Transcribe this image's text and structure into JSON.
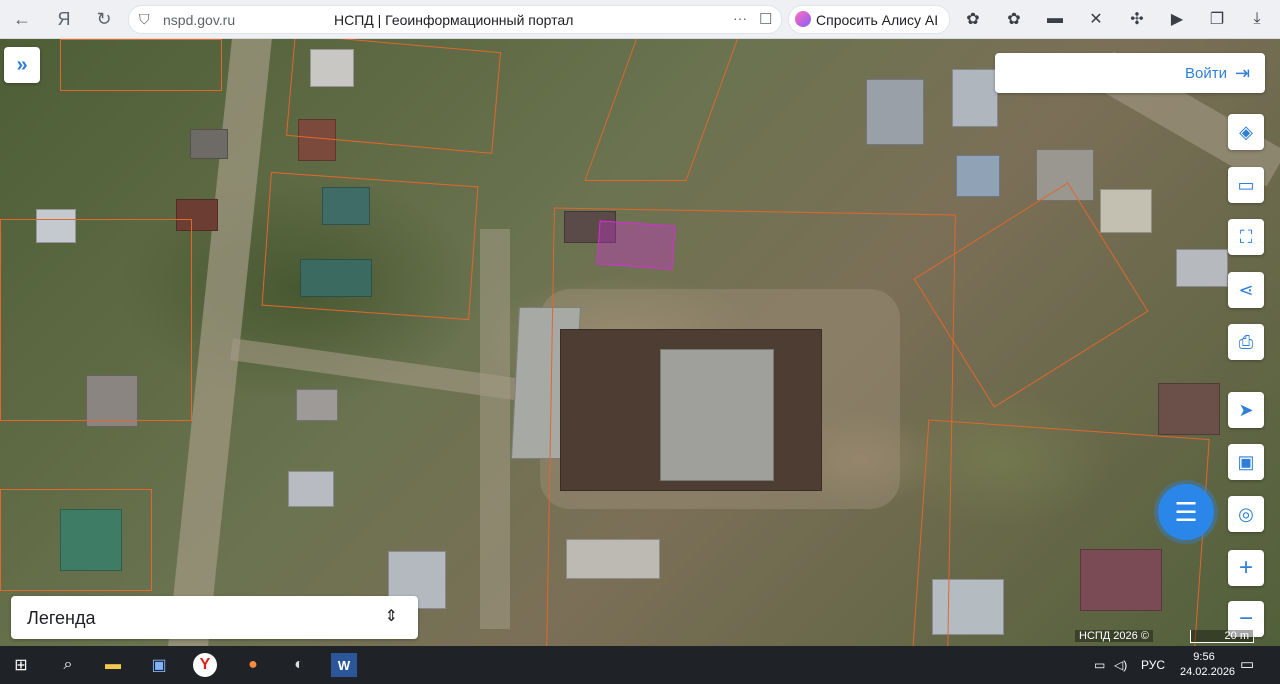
{
  "browser": {
    "url": "nspd.gov.ru",
    "title": "НСПД | Геоинформационный портал",
    "menu_dots": "···",
    "alice_label": "Спросить Алису AI"
  },
  "map": {
    "login_label": "Войти",
    "legend_label": "Легенда",
    "attribution": "НСПД 2026 ©",
    "scale_label": "20 m",
    "tools": [
      "layers-icon",
      "ruler-icon",
      "area-select-icon",
      "share-icon",
      "print-icon",
      "locate-icon",
      "basemap-icon",
      "search-location-icon",
      "zoom-in-icon",
      "zoom-out-icon"
    ]
  },
  "taskbar": {
    "lang": "РУС",
    "time": "9:56",
    "date": "24.02.2026"
  },
  "colors": {
    "accent": "#2f7fd8",
    "parcel": "#e0672e",
    "highlight": "#d32fd6"
  }
}
